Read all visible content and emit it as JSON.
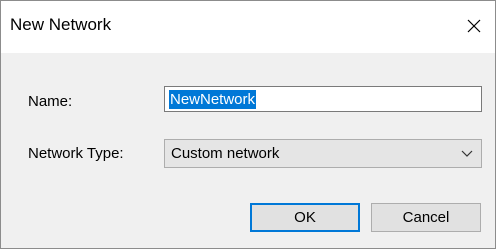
{
  "dialog": {
    "title": "New Network",
    "close_icon": "close-icon"
  },
  "form": {
    "name_label": "Name:",
    "name_value": "NewNetwork",
    "type_label": "Network Type:",
    "type_value": "Custom network",
    "dropdown_icon": "chevron-down-icon"
  },
  "buttons": {
    "ok_label": "OK",
    "cancel_label": "Cancel"
  },
  "colors": {
    "selection": "#0078d7",
    "default_button_border": "#0078d7"
  }
}
